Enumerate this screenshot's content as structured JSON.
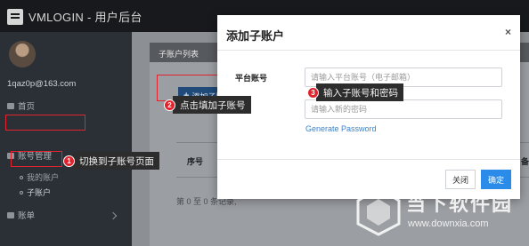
{
  "app": {
    "title": "VMLOGIN - 用户后台"
  },
  "user": {
    "email": "1qaz0p@163.com"
  },
  "sidebar": {
    "home": "首页",
    "account_mgmt": "账号管理",
    "sub_items": [
      "我的账户",
      "子账户"
    ],
    "bill": "账单"
  },
  "panel": {
    "title": "子账户列表",
    "add_button": "添加子账户",
    "col_seq": "序号",
    "col_right": "备",
    "footer": "第 0 至 0 条记录,"
  },
  "modal": {
    "title": "添加子账户",
    "close_glyph": "×",
    "label_platform": "平台账号",
    "account_placeholder": "请输入平台账号（电子邮箱）",
    "password_placeholder": "请输入新的密码",
    "generate_link": "Generate Password",
    "close_button": "关闭",
    "ok_button": "确定"
  },
  "callouts": [
    {
      "num": "1",
      "text": "切换到子账号页面"
    },
    {
      "num": "2",
      "text": "点击填加子账号"
    },
    {
      "num": "3",
      "text": "输入子账号和密码"
    }
  ],
  "watermark": {
    "title": "当下软件园",
    "url": "www.downxia.com"
  },
  "colors": {
    "accent": "#2b8be8",
    "highlight": "#e0232d",
    "sidebar": "#2a3036"
  }
}
